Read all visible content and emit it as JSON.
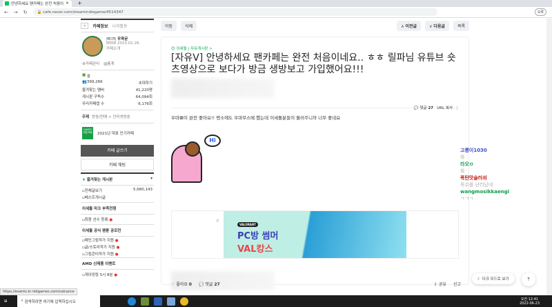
{
  "browser": {
    "tab_title": "안녕하세요 팬카페는 완전 처음이",
    "url": "cafe.naver.com/steamindiegame/4514347",
    "profile": "오류",
    "status_url": "https://events.kr.riotgames.com/valcance"
  },
  "sidebar": {
    "tab_info": "카페정보",
    "tab_activity": "나의활동",
    "manager_badge": "매니저",
    "manager": "우왁굳",
    "since": "since 2015.02.26.",
    "intro": "카페소개",
    "manage": "카페관리",
    "stats": "통계",
    "level": "숲",
    "members": "399,266",
    "invite": "초대하기",
    "stats_rows": [
      {
        "label": "즐겨찾는 멤버",
        "value": "41,220명"
      },
      {
        "label": "게시판 구독수",
        "value": "64,094회"
      },
      {
        "label": "우리카페앱 수",
        "value": "6,176회"
      }
    ],
    "topic_label": "주제",
    "topic": "방송/연예 > 인터넷방송",
    "award": "2021년 대표 인기카페",
    "naver_badge": "NAVER 대표카페",
    "write": "카페 글쓰기",
    "chat": "카페 채팅",
    "fav_boards": "즐겨찾는 게시판",
    "all_posts": "전체글보기",
    "all_count": "5,680,143",
    "best": "베스트게시글",
    "sections": [
      {
        "title": "이세돌 마크 부족전쟁",
        "items": [
          "최종 선수 등록"
        ]
      },
      {
        "title": "이세돌 공식 팬툰 공모전",
        "items": [
          "메인그림작가 지원",
          "글/스토리작가 지원",
          "그림콘티작가 지원"
        ]
      },
      {
        "title": "AMD 신제품 이벤트",
        "items": [
          "게이밍링 5시 8분"
        ]
      }
    ]
  },
  "toolbar": {
    "move": "이동",
    "delete": "삭제",
    "prev": "이전글",
    "next": "다음글",
    "list": "목록"
  },
  "post": {
    "board": "이세돌 | 자유게시판 >",
    "title": "[자유ᐯ] 안녕하세요 팬카페는 완전 처음이네요.. ㅎㅎ 릴파님 유튜브 숏츠영상으로 보다가 방금 생방보고 가입했어요!!!",
    "comments_label": "댓글",
    "comments": "27",
    "url_copy": "URL 복사",
    "body": "우마뾰이 완전 좋아요!! 평소에도 우마무스메 했는데 이세돌분들이 불러주니까 너무 좋네요",
    "sticker_text": "Hi",
    "banner_brand": "VALORANT",
    "banner_line1": "PC방 썸머",
    "banner_line2": "VAL캉스",
    "like_label": "좋아요",
    "likes": "0",
    "share": "공유",
    "report": "신고"
  },
  "chat": [
    {
      "user": "고릉이1030",
      "msg": "와",
      "color": "#3b4fc4"
    },
    {
      "user": "라오ㅁ",
      "msg": "와",
      "color": "#0e9a4a"
    },
    {
      "user": "폭탄맛슬러쉬",
      "msg": "목수를 난리났네",
      "color": "#c0180c"
    },
    {
      "user": "wangmosikkaengi",
      "msg": "ㄱㄱㄱ",
      "color": "#0e9a4a"
    }
  ],
  "floating": {
    "dark_mode": "다크 모드로 보기"
  },
  "taskbar": {
    "search": "검색하려면 여기에 입력하십시오",
    "time": "오전 12:41",
    "date": "2022-06-23"
  }
}
